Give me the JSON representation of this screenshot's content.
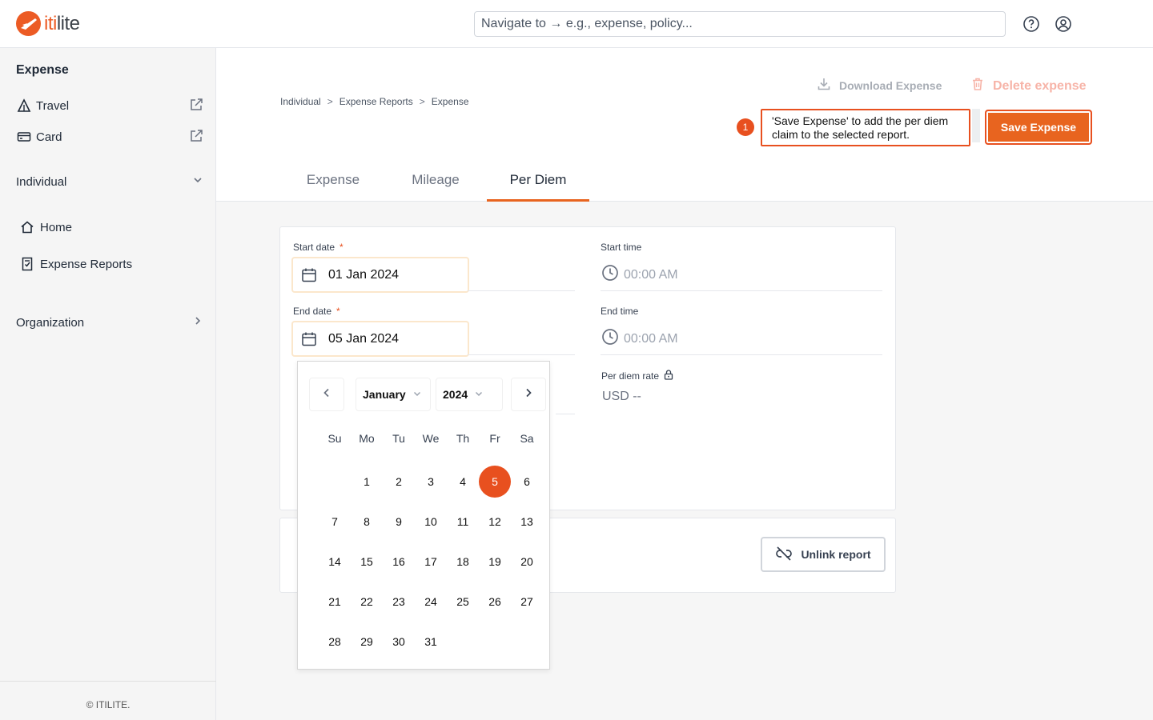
{
  "header": {
    "logo_prefix": "iti",
    "logo_suffix": "lite",
    "search_placeholder": "Navigate to → e.g., expense, policy...",
    "help_icon": "help-circle-icon",
    "profile_icon": "user-circle-icon"
  },
  "sidebar": {
    "title": "Expense",
    "links": [
      {
        "label": "Travel",
        "icon": "travel-icon"
      },
      {
        "label": "Card",
        "icon": "card-icon"
      }
    ],
    "sections": {
      "individual": "Individual",
      "organization": "Organization"
    },
    "nav": [
      {
        "label": "Home",
        "icon": "home-icon"
      },
      {
        "label": "Expense Reports",
        "icon": "receipt-icon"
      }
    ],
    "footer": "© ITILITE."
  },
  "breadcrumb": [
    "Individual",
    "Expense Reports",
    "Expense"
  ],
  "breadcrumb_sep": ">",
  "actions": {
    "download": "Download Expense",
    "delete": "Delete expense",
    "save": "Save Expense"
  },
  "callout": {
    "step": "1",
    "text": "'Save Expense' to add the per diem claim to the selected report."
  },
  "tabs": [
    {
      "label": "Expense",
      "active": false
    },
    {
      "label": "Mileage",
      "active": false
    },
    {
      "label": "Per Diem",
      "active": true
    }
  ],
  "form": {
    "start_date_label": "Start date",
    "start_date": "01 Jan 2024",
    "end_date_label": "End date",
    "end_date": "05 Jan 2024",
    "required_mark": "*",
    "start_time_label": "Start time",
    "start_time": "00:00 AM",
    "end_time_label": "End time",
    "end_time": "00:00 AM",
    "rate_label": "Per diem rate",
    "rate_value": "USD --"
  },
  "report_card": {
    "unlink": "Unlink report"
  },
  "calendar": {
    "month": "January",
    "year": "2024",
    "weekdays": [
      "Su",
      "Mo",
      "Tu",
      "We",
      "Th",
      "Fr",
      "Sa"
    ],
    "first_weekday_index": 1,
    "days_in_month": 31,
    "selected_day": 5
  },
  "colors": {
    "brand": "#e8641f",
    "accent": "#e8501f"
  }
}
